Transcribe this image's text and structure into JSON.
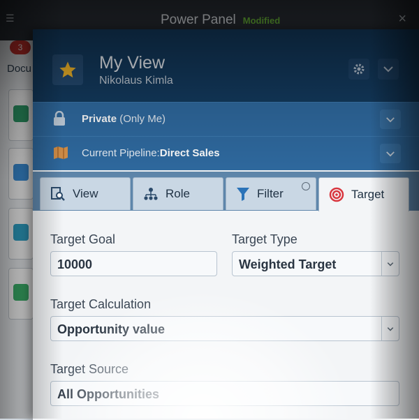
{
  "background_app": {
    "title": "Power Panel",
    "status": "Modified",
    "badge": "3",
    "side_label": "Docu",
    "close_label": "×"
  },
  "panel": {
    "view_title": "My View",
    "user_name": "Nikolaus Kimla",
    "privacy": {
      "bold": "Private",
      "rest": " (Only Me)"
    },
    "pipeline": {
      "prefix": "Current Pipeline:",
      "name": "Direct Sales"
    },
    "tabs": [
      {
        "label": "View",
        "icon": "view-search-icon"
      },
      {
        "label": "Role",
        "icon": "role-hierarchy-icon"
      },
      {
        "label": "Filter",
        "icon": "filter-funnel-icon"
      },
      {
        "label": "Target",
        "icon": "target-icon",
        "active": true
      }
    ],
    "fields": {
      "target_goal": {
        "label": "Target Goal",
        "value": "10000"
      },
      "target_type": {
        "label": "Target Type",
        "value": "Weighted Target"
      },
      "target_calculation": {
        "label": "Target Calculation",
        "value": "Opportunity value"
      },
      "target_source": {
        "label": "Target Source",
        "value": "All Opportunities"
      }
    }
  },
  "colors": {
    "header_bg": "#133a5e",
    "row_bg": "#2f6aa0",
    "star": "#f0b429",
    "target_red": "#d9363e"
  }
}
